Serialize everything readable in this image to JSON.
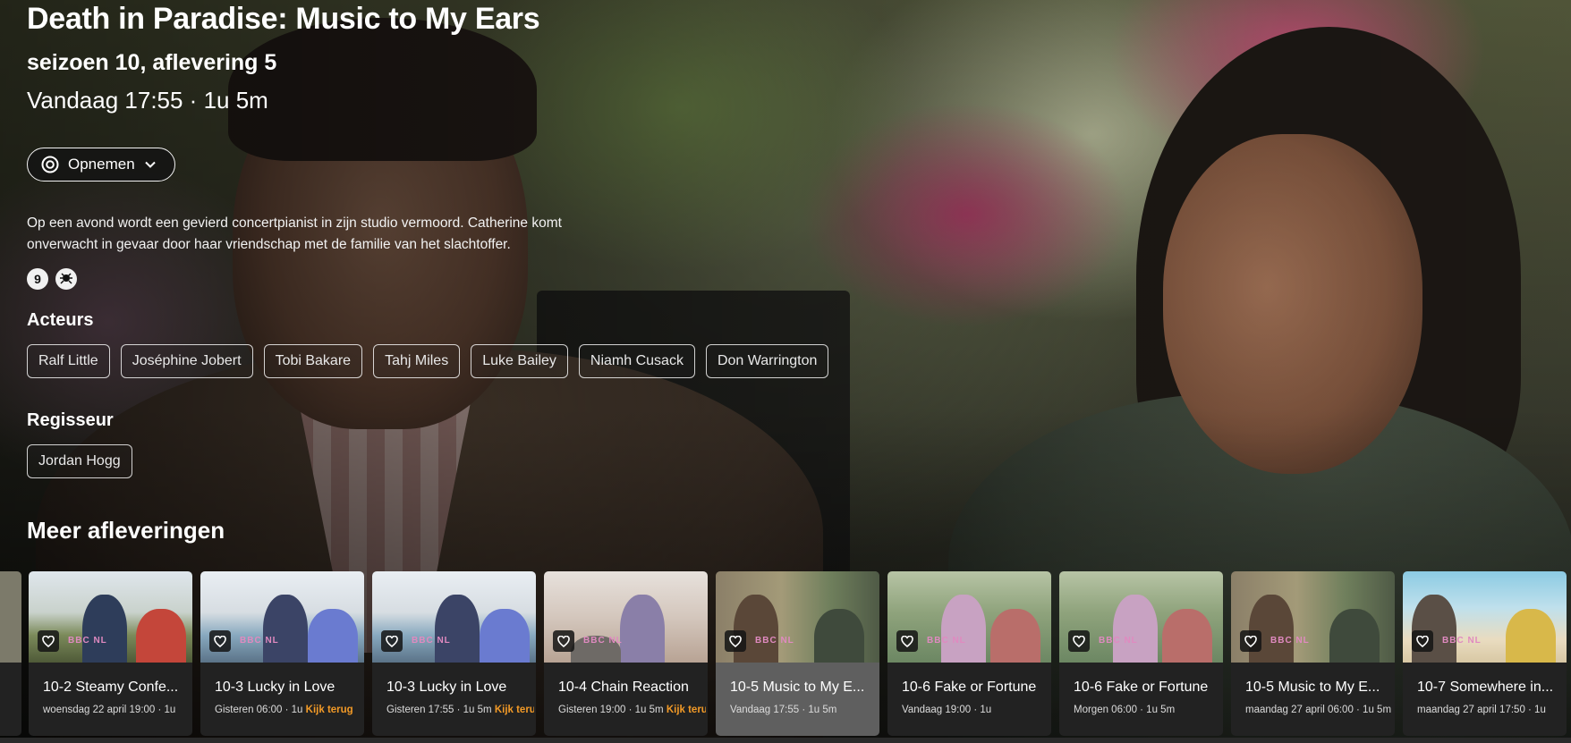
{
  "program": {
    "title": "Death in Paradise: Music to My Ears",
    "subtitle": "seizoen 10, aflevering 5",
    "airtime": "Vandaag 17:55 · 1u 5m",
    "record_label": "Opnemen",
    "description": "Op een avond wordt een gevierd concertpianist in zijn studio vermoord. Catherine komt onverwacht in gevaar door haar vriendschap met de familie van het slachtoffer.",
    "age_rating": "9",
    "content_icon": "fear-icon"
  },
  "actors": {
    "heading": "Acteurs",
    "names": [
      "Ralf Little",
      "Joséphine Jobert",
      "Tobi Bakare",
      "Tahj Miles",
      "Luke Bailey",
      "Niamh Cusack",
      "Don Warrington"
    ]
  },
  "director": {
    "heading": "Regisseur",
    "names": [
      "Jordan Hogg"
    ]
  },
  "more_episodes": {
    "heading": "Meer afleveringen",
    "channel_logo": "BBC NL",
    "items": [
      {
        "title": "10-2 Steamy Confe...",
        "meta": "woensdag 22 april 19:00 · 1u",
        "cta": ""
      },
      {
        "title": "10-3 Lucky in Love",
        "meta": "Gisteren 06:00 · 1u ",
        "cta": "Kijk terug"
      },
      {
        "title": "10-3 Lucky in Love",
        "meta": "Gisteren 17:55 · 1u 5m ",
        "cta": "Kijk terug"
      },
      {
        "title": "10-4 Chain Reaction",
        "meta": "Gisteren 19:00 · 1u 5m ",
        "cta": "Kijk terug"
      },
      {
        "title": "10-5 Music to My E...",
        "meta": "Vandaag 17:55 · 1u 5m",
        "cta": ""
      },
      {
        "title": "10-6 Fake or Fortune",
        "meta": "Vandaag 19:00 · 1u",
        "cta": ""
      },
      {
        "title": "10-6 Fake or Fortune",
        "meta": "Morgen 06:00 · 1u 5m",
        "cta": ""
      },
      {
        "title": "10-5 Music to My E...",
        "meta": "maandag 27 april 06:00 · 1u 5m",
        "cta": ""
      },
      {
        "title": "10-7 Somewhere in...",
        "meta": "maandag 27 april 17:50 · 1u",
        "cta": ""
      }
    ]
  },
  "colors": {
    "accent_cta": "#f29a27",
    "active_card": "#5f5f5f",
    "card_bg": "#222222"
  }
}
